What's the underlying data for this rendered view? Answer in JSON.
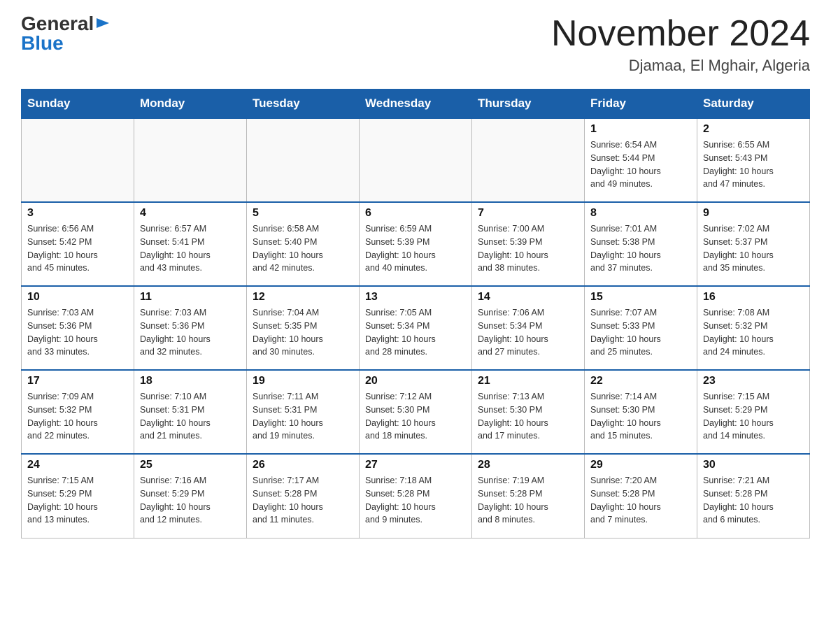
{
  "logo": {
    "general": "General",
    "blue": "Blue"
  },
  "header": {
    "month_year": "November 2024",
    "location": "Djamaa, El Mghair, Algeria"
  },
  "days_of_week": [
    "Sunday",
    "Monday",
    "Tuesday",
    "Wednesday",
    "Thursday",
    "Friday",
    "Saturday"
  ],
  "weeks": [
    [
      {
        "day": "",
        "info": ""
      },
      {
        "day": "",
        "info": ""
      },
      {
        "day": "",
        "info": ""
      },
      {
        "day": "",
        "info": ""
      },
      {
        "day": "",
        "info": ""
      },
      {
        "day": "1",
        "info": "Sunrise: 6:54 AM\nSunset: 5:44 PM\nDaylight: 10 hours\nand 49 minutes."
      },
      {
        "day": "2",
        "info": "Sunrise: 6:55 AM\nSunset: 5:43 PM\nDaylight: 10 hours\nand 47 minutes."
      }
    ],
    [
      {
        "day": "3",
        "info": "Sunrise: 6:56 AM\nSunset: 5:42 PM\nDaylight: 10 hours\nand 45 minutes."
      },
      {
        "day": "4",
        "info": "Sunrise: 6:57 AM\nSunset: 5:41 PM\nDaylight: 10 hours\nand 43 minutes."
      },
      {
        "day": "5",
        "info": "Sunrise: 6:58 AM\nSunset: 5:40 PM\nDaylight: 10 hours\nand 42 minutes."
      },
      {
        "day": "6",
        "info": "Sunrise: 6:59 AM\nSunset: 5:39 PM\nDaylight: 10 hours\nand 40 minutes."
      },
      {
        "day": "7",
        "info": "Sunrise: 7:00 AM\nSunset: 5:39 PM\nDaylight: 10 hours\nand 38 minutes."
      },
      {
        "day": "8",
        "info": "Sunrise: 7:01 AM\nSunset: 5:38 PM\nDaylight: 10 hours\nand 37 minutes."
      },
      {
        "day": "9",
        "info": "Sunrise: 7:02 AM\nSunset: 5:37 PM\nDaylight: 10 hours\nand 35 minutes."
      }
    ],
    [
      {
        "day": "10",
        "info": "Sunrise: 7:03 AM\nSunset: 5:36 PM\nDaylight: 10 hours\nand 33 minutes."
      },
      {
        "day": "11",
        "info": "Sunrise: 7:03 AM\nSunset: 5:36 PM\nDaylight: 10 hours\nand 32 minutes."
      },
      {
        "day": "12",
        "info": "Sunrise: 7:04 AM\nSunset: 5:35 PM\nDaylight: 10 hours\nand 30 minutes."
      },
      {
        "day": "13",
        "info": "Sunrise: 7:05 AM\nSunset: 5:34 PM\nDaylight: 10 hours\nand 28 minutes."
      },
      {
        "day": "14",
        "info": "Sunrise: 7:06 AM\nSunset: 5:34 PM\nDaylight: 10 hours\nand 27 minutes."
      },
      {
        "day": "15",
        "info": "Sunrise: 7:07 AM\nSunset: 5:33 PM\nDaylight: 10 hours\nand 25 minutes."
      },
      {
        "day": "16",
        "info": "Sunrise: 7:08 AM\nSunset: 5:32 PM\nDaylight: 10 hours\nand 24 minutes."
      }
    ],
    [
      {
        "day": "17",
        "info": "Sunrise: 7:09 AM\nSunset: 5:32 PM\nDaylight: 10 hours\nand 22 minutes."
      },
      {
        "day": "18",
        "info": "Sunrise: 7:10 AM\nSunset: 5:31 PM\nDaylight: 10 hours\nand 21 minutes."
      },
      {
        "day": "19",
        "info": "Sunrise: 7:11 AM\nSunset: 5:31 PM\nDaylight: 10 hours\nand 19 minutes."
      },
      {
        "day": "20",
        "info": "Sunrise: 7:12 AM\nSunset: 5:30 PM\nDaylight: 10 hours\nand 18 minutes."
      },
      {
        "day": "21",
        "info": "Sunrise: 7:13 AM\nSunset: 5:30 PM\nDaylight: 10 hours\nand 17 minutes."
      },
      {
        "day": "22",
        "info": "Sunrise: 7:14 AM\nSunset: 5:30 PM\nDaylight: 10 hours\nand 15 minutes."
      },
      {
        "day": "23",
        "info": "Sunrise: 7:15 AM\nSunset: 5:29 PM\nDaylight: 10 hours\nand 14 minutes."
      }
    ],
    [
      {
        "day": "24",
        "info": "Sunrise: 7:15 AM\nSunset: 5:29 PM\nDaylight: 10 hours\nand 13 minutes."
      },
      {
        "day": "25",
        "info": "Sunrise: 7:16 AM\nSunset: 5:29 PM\nDaylight: 10 hours\nand 12 minutes."
      },
      {
        "day": "26",
        "info": "Sunrise: 7:17 AM\nSunset: 5:28 PM\nDaylight: 10 hours\nand 11 minutes."
      },
      {
        "day": "27",
        "info": "Sunrise: 7:18 AM\nSunset: 5:28 PM\nDaylight: 10 hours\nand 9 minutes."
      },
      {
        "day": "28",
        "info": "Sunrise: 7:19 AM\nSunset: 5:28 PM\nDaylight: 10 hours\nand 8 minutes."
      },
      {
        "day": "29",
        "info": "Sunrise: 7:20 AM\nSunset: 5:28 PM\nDaylight: 10 hours\nand 7 minutes."
      },
      {
        "day": "30",
        "info": "Sunrise: 7:21 AM\nSunset: 5:28 PM\nDaylight: 10 hours\nand 6 minutes."
      }
    ]
  ]
}
